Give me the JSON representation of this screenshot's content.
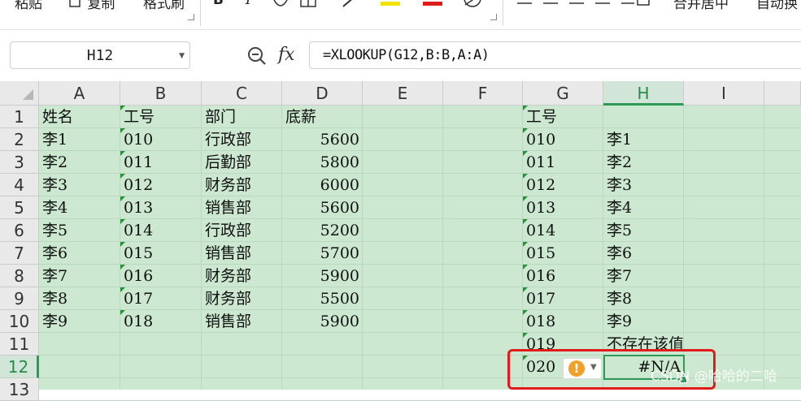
{
  "ribbon": {
    "items": [
      "粘贴",
      "复制",
      "格式刷",
      "B",
      "I",
      "合并居中",
      "自动换"
    ]
  },
  "formula_bar": {
    "name_box": "H12",
    "formula": "=XLOOKUP(G12,B:B,A:A)"
  },
  "columns": [
    "A",
    "B",
    "C",
    "D",
    "E",
    "F",
    "G",
    "H",
    "I"
  ],
  "rows": [
    "1",
    "2",
    "3",
    "4",
    "5",
    "6",
    "7",
    "8",
    "9",
    "10",
    "11",
    "12",
    "13"
  ],
  "active_cell": {
    "column": "H",
    "row": "12"
  },
  "table": {
    "headers": [
      "姓名",
      "工号",
      "部门",
      "底薪"
    ],
    "records": [
      [
        "李1",
        "010",
        "行政部",
        "5600"
      ],
      [
        "李2",
        "011",
        "后勤部",
        "5800"
      ],
      [
        "李3",
        "012",
        "财务部",
        "6000"
      ],
      [
        "李4",
        "013",
        "销售部",
        "5600"
      ],
      [
        "李5",
        "014",
        "行政部",
        "5200"
      ],
      [
        "李6",
        "015",
        "销售部",
        "5700"
      ],
      [
        "李7",
        "016",
        "财务部",
        "5900"
      ],
      [
        "李8",
        "017",
        "财务部",
        "5500"
      ],
      [
        "李9",
        "018",
        "销售部",
        "5900"
      ]
    ]
  },
  "lookup": {
    "header": "工号",
    "rows": [
      [
        "010",
        "李1"
      ],
      [
        "011",
        "李2"
      ],
      [
        "012",
        "李3"
      ],
      [
        "013",
        "李4"
      ],
      [
        "014",
        "李5"
      ],
      [
        "015",
        "李6"
      ],
      [
        "016",
        "李7"
      ],
      [
        "017",
        "李8"
      ],
      [
        "018",
        "李9"
      ],
      [
        "019",
        "不存在该值"
      ],
      [
        "020",
        "#N/A"
      ]
    ]
  },
  "watermark": "CSDN @哈哈的二哈",
  "colors": {
    "grid_fill": "#cce8d0",
    "selection": "#2f9a55",
    "highlight_box": "#e01b1b",
    "warning": "#f0a12a"
  }
}
